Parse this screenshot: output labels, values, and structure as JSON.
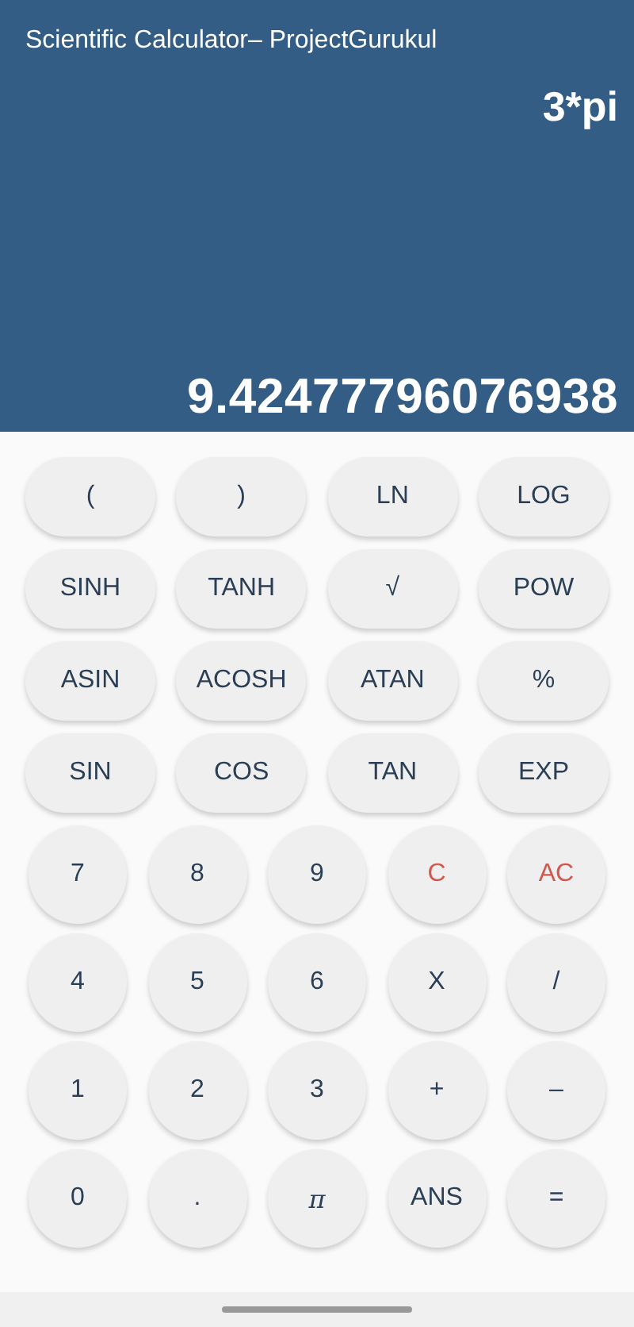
{
  "header": {
    "title": "Scientific Calculator– ProjectGurukul",
    "expression": "3*pi",
    "result": "9.42477796076938"
  },
  "function_rows": [
    [
      {
        "label": "(",
        "kind": "plain"
      },
      {
        "label": ")",
        "kind": "plain"
      },
      {
        "label": "LN",
        "kind": "plain"
      },
      {
        "label": "LOG",
        "kind": "plain"
      }
    ],
    [
      {
        "label": "SINH",
        "kind": "plain"
      },
      {
        "label": "TANH",
        "kind": "plain"
      },
      {
        "label": "√",
        "kind": "plain"
      },
      {
        "label": "POW",
        "kind": "plain"
      }
    ],
    [
      {
        "label": "ASIN",
        "kind": "plain"
      },
      {
        "label": "ACOSH",
        "kind": "plain"
      },
      {
        "label": "ATAN",
        "kind": "plain"
      },
      {
        "label": "%",
        "kind": "plain"
      }
    ],
    [
      {
        "label": "SIN",
        "kind": "plain"
      },
      {
        "label": "COS",
        "kind": "plain"
      },
      {
        "label": "TAN",
        "kind": "plain"
      },
      {
        "label": "EXP",
        "kind": "plain"
      }
    ]
  ],
  "keypad_rows": [
    [
      {
        "label": "7",
        "kind": "plain"
      },
      {
        "label": "8",
        "kind": "plain"
      },
      {
        "label": "9",
        "kind": "plain"
      },
      {
        "label": "C",
        "kind": "clear"
      },
      {
        "label": "AC",
        "kind": "clear"
      }
    ],
    [
      {
        "label": "4",
        "kind": "plain"
      },
      {
        "label": "5",
        "kind": "plain"
      },
      {
        "label": "6",
        "kind": "plain"
      },
      {
        "label": "X",
        "kind": "plain"
      },
      {
        "label": "/",
        "kind": "plain"
      }
    ],
    [
      {
        "label": "1",
        "kind": "plain"
      },
      {
        "label": "2",
        "kind": "plain"
      },
      {
        "label": "3",
        "kind": "plain"
      },
      {
        "label": "+",
        "kind": "plain"
      },
      {
        "label": "–",
        "kind": "plain"
      }
    ],
    [
      {
        "label": "0",
        "kind": "plain"
      },
      {
        "label": ".",
        "kind": "plain"
      },
      {
        "label": "π",
        "kind": "symbol"
      },
      {
        "label": "ANS",
        "kind": "plain"
      },
      {
        "label": "=",
        "kind": "plain"
      }
    ]
  ]
}
